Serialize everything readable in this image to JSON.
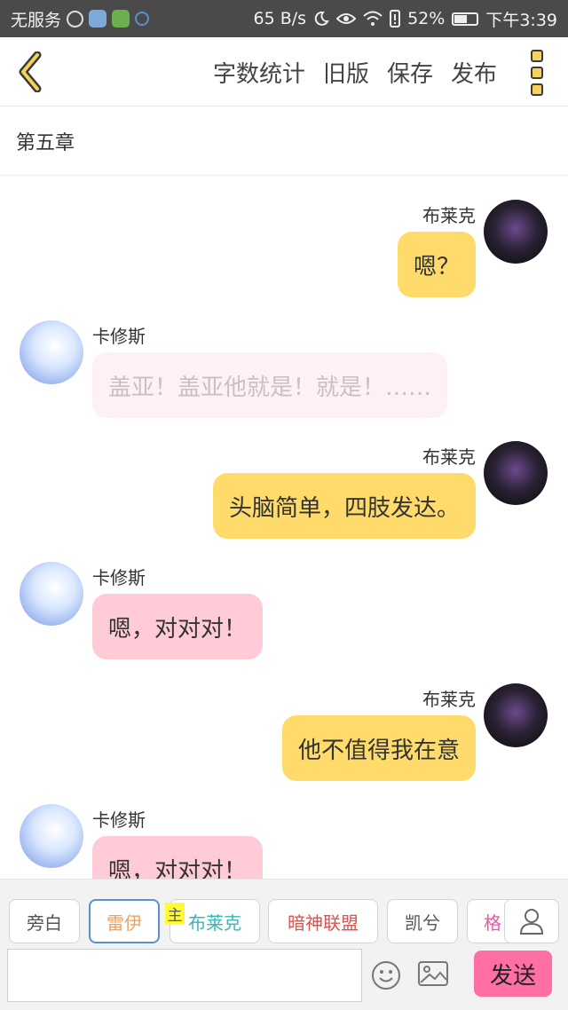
{
  "status_bar": {
    "carrier": "无服务",
    "speed": "65 B/s",
    "battery": "52%",
    "time": "下午3:39",
    "icons": [
      "k-app-icon",
      "app-icon",
      "play-icon",
      "leaf-icon",
      "moon-icon",
      "eye-icon",
      "wifi-icon",
      "alert-icon",
      "battery-icon"
    ]
  },
  "toolbar": {
    "back_icon": "chevron-left-icon",
    "word_count": "字数统计",
    "old_version": "旧版",
    "save": "保存",
    "publish": "发布",
    "more_icon": "more-vertical-icon"
  },
  "chapter_title": "第五章",
  "messages": [
    {
      "side": "right",
      "speaker": "布莱克",
      "text": "嗯？",
      "style": "yellow"
    },
    {
      "side": "left",
      "speaker": "卡修斯",
      "text": "盖亚！盖亚他就是！就是！……",
      "style": "faded"
    },
    {
      "side": "right",
      "speaker": "布莱克",
      "text": "头脑简单，四肢发达。",
      "style": "yellow"
    },
    {
      "side": "left",
      "speaker": "卡修斯",
      "text": "嗯，对对对！",
      "style": "pink"
    },
    {
      "side": "right",
      "speaker": "布莱克",
      "text": "他不值得我在意",
      "style": "yellow"
    },
    {
      "side": "left",
      "speaker": "卡修斯",
      "text": "嗯，对对对！",
      "style": "pink"
    }
  ],
  "characters": [
    {
      "label": "旁白",
      "color": "#555555"
    },
    {
      "label": "雷伊",
      "color": "#f0a060"
    },
    {
      "label": "布莱克",
      "color": "#39b8b0"
    },
    {
      "label": "暗神联盟",
      "color": "#d9534f"
    },
    {
      "label": "凯兮",
      "color": "#555555"
    },
    {
      "label": "格",
      "color": "#e05aa8"
    }
  ],
  "main_mark": "主",
  "input": {
    "value": "",
    "placeholder": ""
  },
  "send_label": "发送",
  "colors": {
    "accent_yellow": "#fedb6b",
    "accent_pink": "#ffcbd7",
    "send": "#ff6fa3"
  }
}
